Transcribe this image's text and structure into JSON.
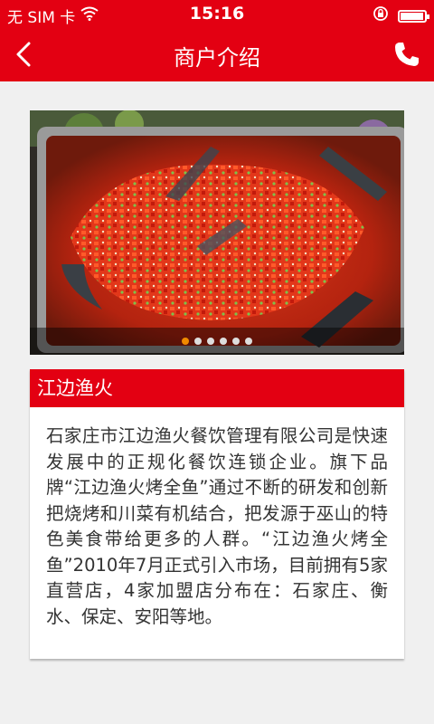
{
  "status_bar": {
    "carrier": "无 SIM 卡",
    "time": "15:16",
    "icons": [
      "wifi-icon",
      "lock-rotation-icon",
      "battery-icon"
    ]
  },
  "nav": {
    "title": "商户介绍",
    "back_icon": "chevron-left-icon",
    "phone_icon": "phone-icon"
  },
  "banner": {
    "image": "photo of grilled whole fish topped with chopped red chili peppers",
    "dots_count": 6,
    "active_index": 0
  },
  "merchant": {
    "name": "江边渔火",
    "description": "石家庄市江边渔火餐饮管理有限公司是快速发展中的正规化餐饮连锁企业。旗下品牌“江边渔火烤全鱼”通过不断的研发和创新把烧烤和川菜有机结合，把发源于巫山的特色美食带给更多的人群。“江边渔火烤全鱼”2010年7月正式引入市场，目前拥有5家直营店，4家加盟店分布在：石家庄、衡水、保定、安阳等地。"
  },
  "colors": {
    "brand_red": "#e30012",
    "background": "#f0f0f0",
    "active_dot": "#f08a00"
  }
}
